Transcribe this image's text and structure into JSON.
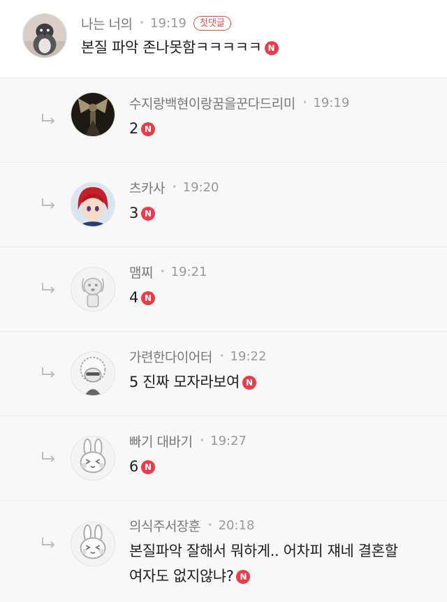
{
  "new_badge": "N",
  "colors": {
    "new_badge": "#ef3b49",
    "first_comment_badge": "#ef4b3f",
    "reply_background": "#f8f8f8"
  },
  "comments": [
    {
      "nickname": "나는 너의",
      "time": "19:19",
      "badge": "첫댓글",
      "text": "본질 파악 존나못함ㅋㅋㅋㅋㅋ",
      "avatar_icon": "penguin-avatar-icon"
    },
    {
      "nickname": "수지랑백현이랑꿈을꾼다드리미",
      "time": "19:19",
      "text": "2",
      "avatar_icon": "dark-figure-avatar-icon"
    },
    {
      "nickname": "츠카사",
      "time": "19:20",
      "text": "3",
      "avatar_icon": "red-hair-anime-avatar-icon"
    },
    {
      "nickname": "맴찌",
      "time": "19:21",
      "text": "4",
      "avatar_icon": "dog-avatar-icon"
    },
    {
      "nickname": "가련한다이어터",
      "time": "19:22",
      "text": "5 진짜 모자라보여",
      "avatar_icon": "afro-character-avatar-icon"
    },
    {
      "nickname": "빠기 대바기",
      "time": "19:27",
      "text": "6",
      "avatar_icon": "rabbit-avatar-icon"
    },
    {
      "nickname": "의식주서장훈",
      "time": "20:18",
      "text_line1": "본질파악 잘해서 뭐하게.. 어차피 쟤네 결혼할",
      "text_line2": "여자도 없지않냐?",
      "avatar_icon": "rabbit-avatar-icon"
    }
  ]
}
